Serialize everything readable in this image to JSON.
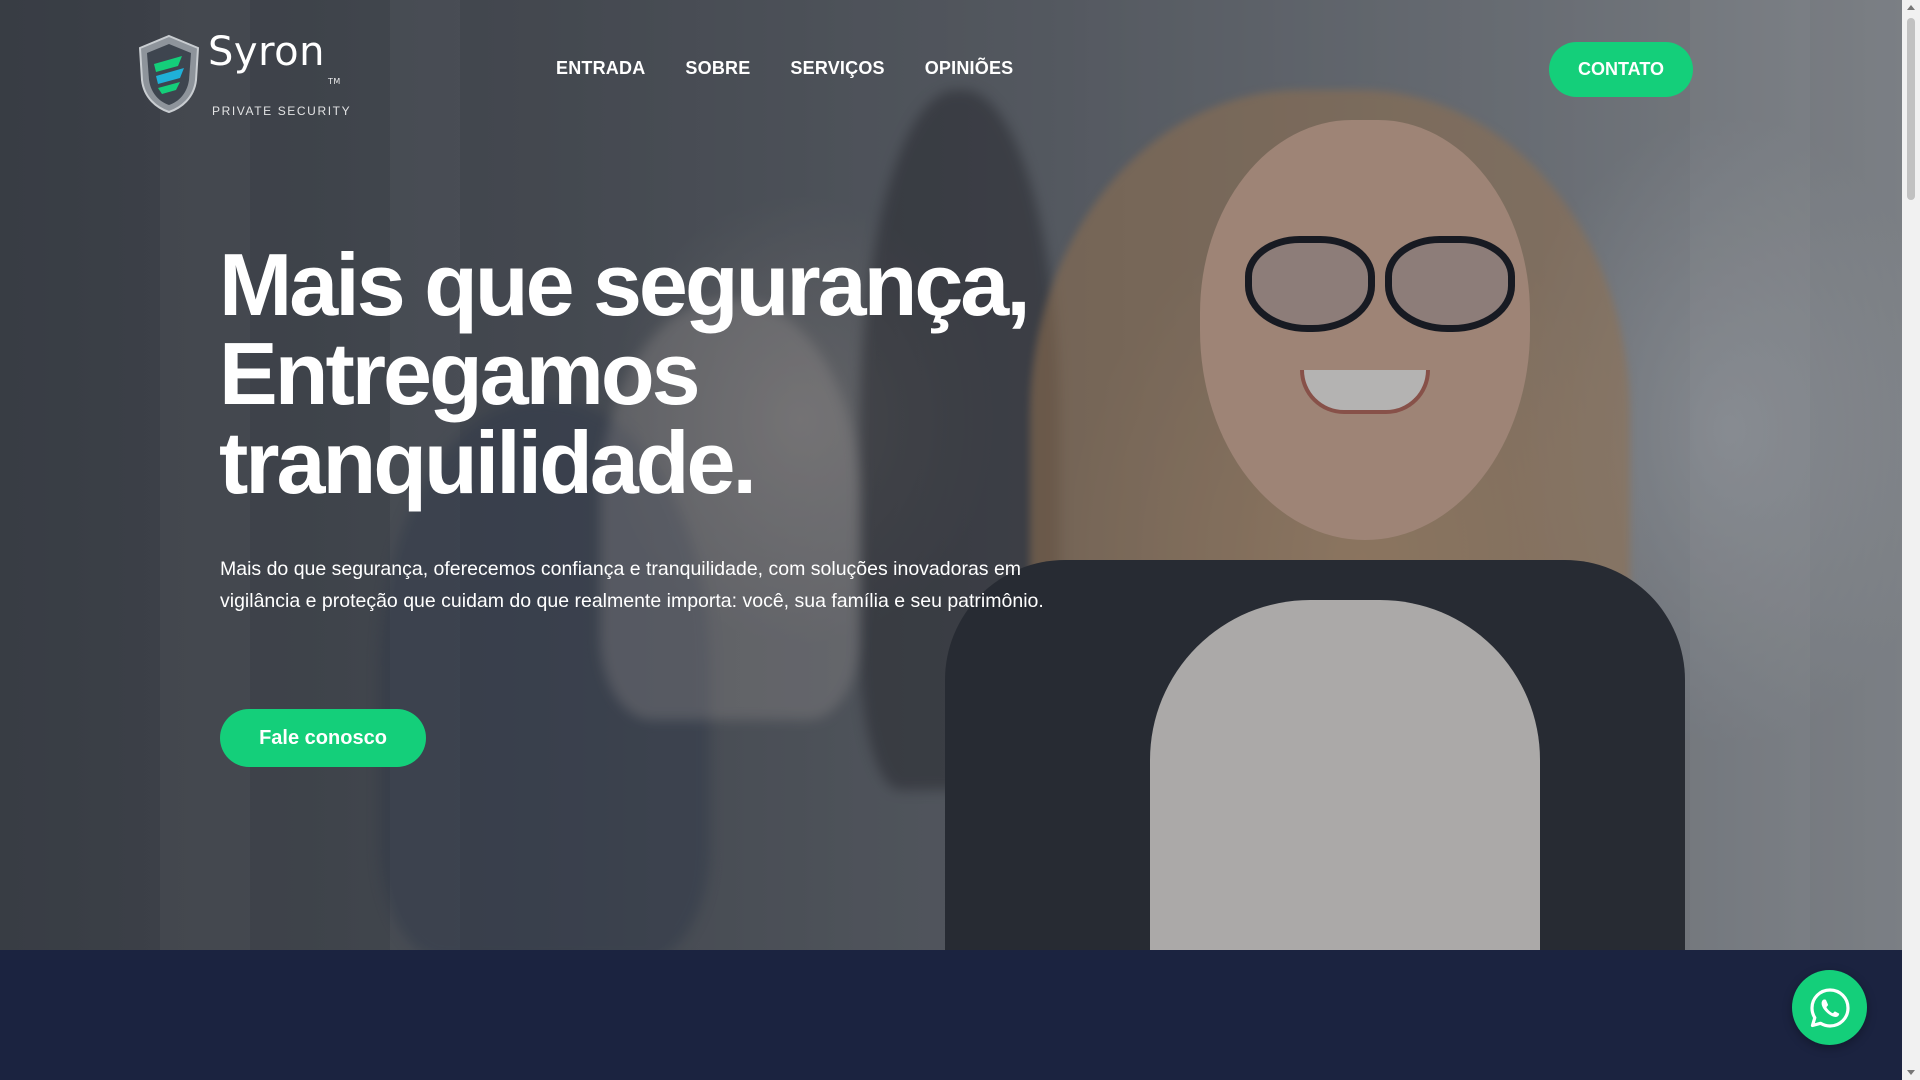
{
  "brand": {
    "name": "Syron",
    "trademark": "TM",
    "tagline": "PRIVATE SECURITY",
    "colors": {
      "accent": "#14cf7a",
      "dark": "#1b2340"
    }
  },
  "nav": {
    "items": [
      {
        "label": "ENTRADA"
      },
      {
        "label": "SOBRE"
      },
      {
        "label": "SERVIÇOS"
      },
      {
        "label": "OPINIÕES"
      }
    ],
    "contact_label": "CONTATO"
  },
  "hero": {
    "title_lines": [
      "Mais que segurança,",
      "Entregamos",
      "tranquilidade."
    ],
    "description": "Mais do que segurança, oferecemos confiança e tranquilidade, com soluções inovadoras em vigilância e proteção que cuidam do que realmente importa: você, sua família e seu patrimônio.",
    "cta_label": "Fale conosco"
  },
  "floating": {
    "icon": "whatsapp-icon"
  }
}
